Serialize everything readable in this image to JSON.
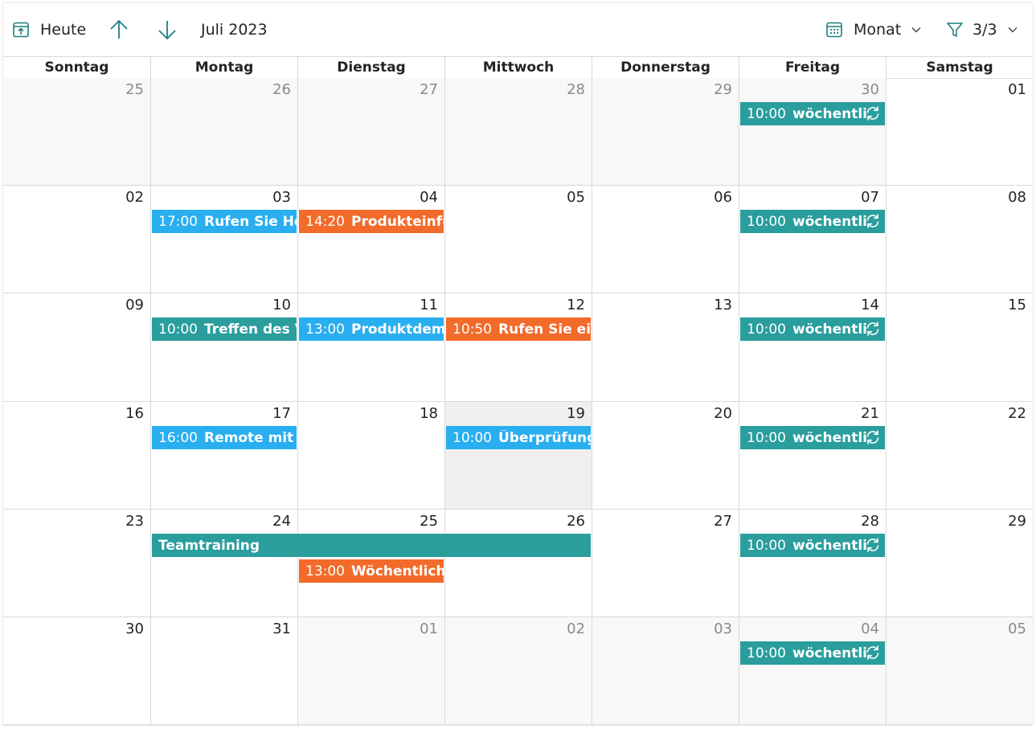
{
  "toolbar": {
    "today_label": "Heute",
    "month_label": "Juli 2023",
    "view_label": "Monat",
    "filter_label": "3/3",
    "icons": {
      "today": "calendar-today-icon",
      "up": "arrow-up-icon",
      "down": "arrow-down-icon",
      "view": "calendar-grid-icon",
      "filter": "filter-icon",
      "chevron": "chevron-down-icon"
    }
  },
  "weekdays": [
    "Sonntag",
    "Montag",
    "Dienstag",
    "Mittwoch",
    "Donnerstag",
    "Freitag",
    "Samstag"
  ],
  "weeks": [
    {
      "days": [
        {
          "num": "25",
          "out": true
        },
        {
          "num": "26",
          "out": true
        },
        {
          "num": "27",
          "out": true
        },
        {
          "num": "28",
          "out": true
        },
        {
          "num": "29",
          "out": true
        },
        {
          "num": "30",
          "out": true
        },
        {
          "num": "01",
          "out": false
        }
      ]
    },
    {
      "days": [
        {
          "num": "02",
          "out": false
        },
        {
          "num": "03",
          "out": false
        },
        {
          "num": "04",
          "out": false
        },
        {
          "num": "05",
          "out": false
        },
        {
          "num": "06",
          "out": false
        },
        {
          "num": "07",
          "out": false
        },
        {
          "num": "08",
          "out": false
        }
      ]
    },
    {
      "days": [
        {
          "num": "09",
          "out": false
        },
        {
          "num": "10",
          "out": false
        },
        {
          "num": "11",
          "out": false
        },
        {
          "num": "12",
          "out": false
        },
        {
          "num": "13",
          "out": false
        },
        {
          "num": "14",
          "out": false
        },
        {
          "num": "15",
          "out": false
        }
      ]
    },
    {
      "days": [
        {
          "num": "16",
          "out": false
        },
        {
          "num": "17",
          "out": false
        },
        {
          "num": "18",
          "out": false
        },
        {
          "num": "19",
          "out": false,
          "today": true
        },
        {
          "num": "20",
          "out": false
        },
        {
          "num": "21",
          "out": false
        },
        {
          "num": "22",
          "out": false
        }
      ]
    },
    {
      "days": [
        {
          "num": "23",
          "out": false
        },
        {
          "num": "24",
          "out": false
        },
        {
          "num": "25",
          "out": false
        },
        {
          "num": "26",
          "out": false
        },
        {
          "num": "27",
          "out": false
        },
        {
          "num": "28",
          "out": false
        },
        {
          "num": "29",
          "out": false
        }
      ]
    },
    {
      "days": [
        {
          "num": "30",
          "out": false
        },
        {
          "num": "31",
          "out": false
        },
        {
          "num": "01",
          "out": true
        },
        {
          "num": "02",
          "out": true
        },
        {
          "num": "03",
          "out": true
        },
        {
          "num": "04",
          "out": true
        },
        {
          "num": "05",
          "out": true
        }
      ]
    }
  ],
  "events": [
    {
      "week": 0,
      "day": 5,
      "span": 1,
      "lane": 0,
      "time": "10:00",
      "title": "wöchentlich",
      "color": "teal",
      "recurring": true
    },
    {
      "week": 1,
      "day": 1,
      "span": 1,
      "lane": 0,
      "time": "17:00",
      "title": "Rufen Sie Herrn",
      "color": "blue",
      "recurring": false
    },
    {
      "week": 1,
      "day": 2,
      "span": 1,
      "lane": 0,
      "time": "14:20",
      "title": "Produkteinführung",
      "color": "orange",
      "recurring": false
    },
    {
      "week": 1,
      "day": 5,
      "span": 1,
      "lane": 0,
      "time": "10:00",
      "title": "wöchentlich",
      "color": "teal",
      "recurring": true
    },
    {
      "week": 2,
      "day": 1,
      "span": 1,
      "lane": 0,
      "time": "10:00",
      "title": "Treffen des Vorstands",
      "color": "teal",
      "recurring": false
    },
    {
      "week": 2,
      "day": 2,
      "span": 1,
      "lane": 0,
      "time": "13:00",
      "title": "Produktdemo",
      "color": "blue",
      "recurring": false
    },
    {
      "week": 2,
      "day": 3,
      "span": 1,
      "lane": 0,
      "time": "10:50",
      "title": "Rufen Sie ein",
      "color": "orange",
      "recurring": false
    },
    {
      "week": 2,
      "day": 5,
      "span": 1,
      "lane": 0,
      "time": "10:00",
      "title": "wöchentlich",
      "color": "teal",
      "recurring": true
    },
    {
      "week": 3,
      "day": 1,
      "span": 1,
      "lane": 0,
      "time": "16:00",
      "title": "Remote mit dem",
      "color": "blue",
      "recurring": false
    },
    {
      "week": 3,
      "day": 3,
      "span": 1,
      "lane": 0,
      "time": "10:00",
      "title": "Überprüfung",
      "color": "blue",
      "recurring": false
    },
    {
      "week": 3,
      "day": 5,
      "span": 1,
      "lane": 0,
      "time": "10:00",
      "title": "wöchentlich",
      "color": "teal",
      "recurring": true
    },
    {
      "week": 4,
      "day": 1,
      "span": 3,
      "lane": 0,
      "time": "",
      "title": "Teamtraining",
      "color": "teal",
      "recurring": false
    },
    {
      "week": 4,
      "day": 2,
      "span": 1,
      "lane": 1,
      "time": "13:00",
      "title": "Wöchentliche",
      "color": "orange",
      "recurring": false
    },
    {
      "week": 4,
      "day": 5,
      "span": 1,
      "lane": 0,
      "time": "10:00",
      "title": "wöchentlich",
      "color": "teal",
      "recurring": true
    },
    {
      "week": 5,
      "day": 5,
      "span": 1,
      "lane": 0,
      "time": "10:00",
      "title": "wöchentlich",
      "color": "teal",
      "recurring": true
    }
  ],
  "colors": {
    "teal": "#2a9d9d",
    "blue": "#29aef0",
    "orange": "#f26b2a",
    "accent": "#1e7f7f",
    "out_of_month_bg": "#f8f8f8",
    "today_bg": "#efefef"
  }
}
